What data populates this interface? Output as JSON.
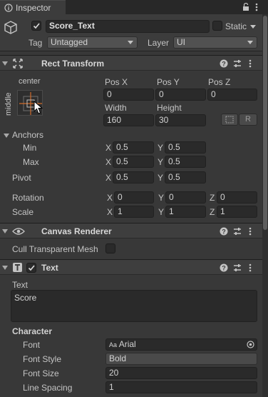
{
  "tab": {
    "label": "Inspector"
  },
  "object": {
    "name": "Score_Text",
    "static_label": "Static",
    "tag_label": "Tag",
    "tag_value": "Untagged",
    "layer_label": "Layer",
    "layer_value": "UI"
  },
  "rect_transform": {
    "title": "Rect Transform",
    "anchor_preset_h": "center",
    "anchor_preset_v": "middle",
    "pos_x_label": "Pos X",
    "pos_y_label": "Pos Y",
    "pos_z_label": "Pos Z",
    "pos_x": "0",
    "pos_y": "0",
    "pos_z": "0",
    "width_label": "Width",
    "height_label": "Height",
    "width": "160",
    "height": "30",
    "raw_button": "R",
    "anchors_label": "Anchors",
    "min_label": "Min",
    "max_label": "Max",
    "min_x": "0.5",
    "min_y": "0.5",
    "max_x": "0.5",
    "max_y": "0.5",
    "pivot_label": "Pivot",
    "pivot_x": "0.5",
    "pivot_y": "0.5",
    "rotation_label": "Rotation",
    "rot_x": "0",
    "rot_y": "0",
    "rot_z": "0",
    "scale_label": "Scale",
    "scale_x": "1",
    "scale_y": "1",
    "scale_z": "1",
    "x": "X",
    "y": "Y",
    "z": "Z"
  },
  "canvas_renderer": {
    "title": "Canvas Renderer",
    "cull_label": "Cull Transparent Mesh"
  },
  "text": {
    "title": "Text",
    "text_label": "Text",
    "text_value": "Score",
    "character_label": "Character",
    "font_label": "Font",
    "font_value": "Arial",
    "font_icon_text": "Aa",
    "font_style_label": "Font Style",
    "font_style_value": "Bold",
    "font_size_label": "Font Size",
    "font_size_value": "20",
    "line_spacing_label": "Line Spacing",
    "line_spacing_value": "1"
  },
  "colors": {
    "bg": "#383838",
    "header": "#3e3e3e",
    "field": "#2a2a2a",
    "accent_anchor": "#d06b2a"
  }
}
